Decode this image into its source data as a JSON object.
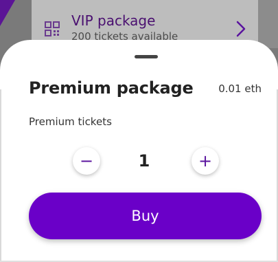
{
  "background_card": {
    "title": "VIP package",
    "subtitle": "200 tickets available",
    "icon": "qr-code-icon",
    "chevron_icon": "chevron-right-icon"
  },
  "sheet": {
    "title": "Premium package",
    "price": "0.01 eth",
    "subtitle": "Premium tickets",
    "quantity": "1",
    "buy_label": "Buy",
    "minus_label": "−",
    "plus_label": "+"
  },
  "colors": {
    "primary": "#6A00C8",
    "primary_dark": "#5A139E",
    "scrim": "#7A7A7A"
  }
}
